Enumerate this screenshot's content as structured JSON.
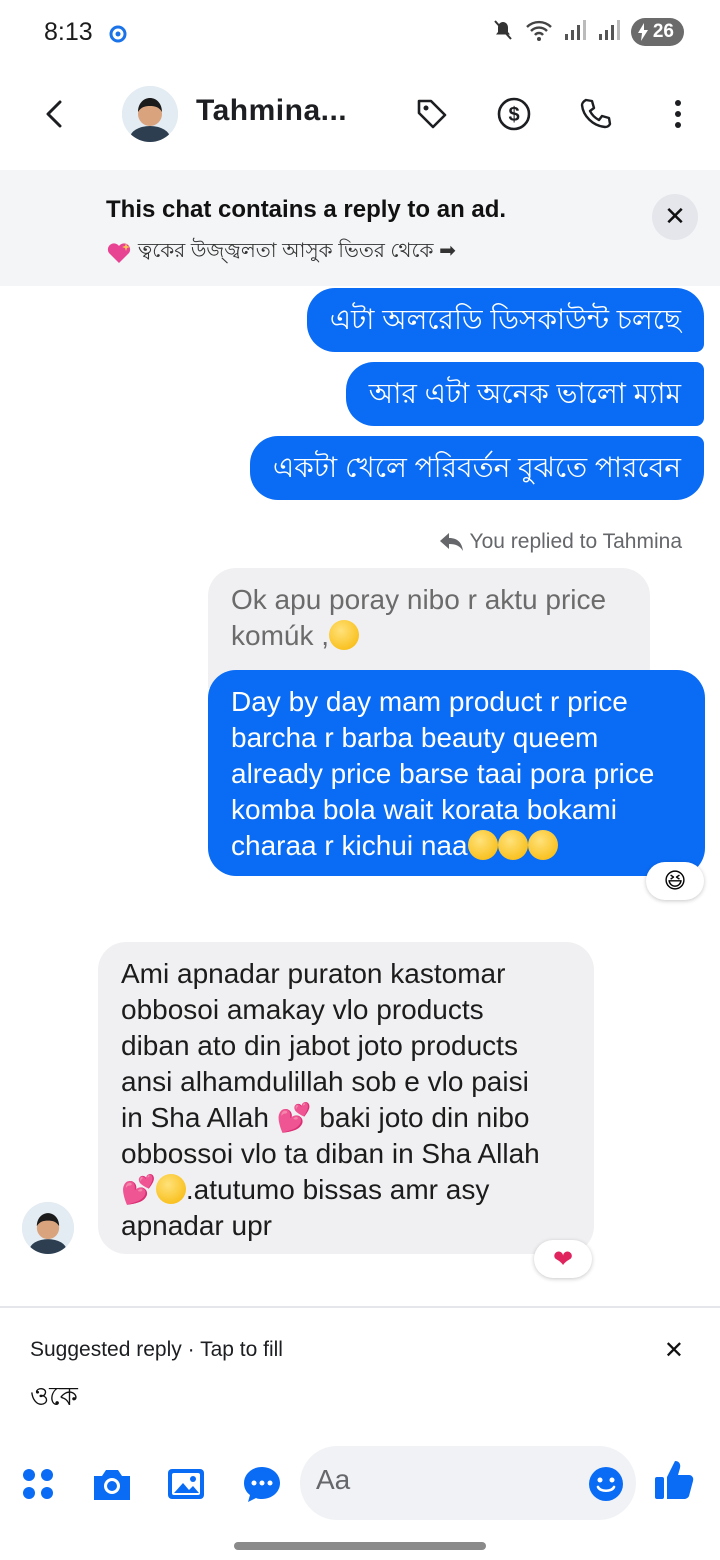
{
  "status_bar": {
    "time": "8:13",
    "battery": "26"
  },
  "header": {
    "contact_name": "Tahmina..."
  },
  "ad_banner": {
    "title": "This chat contains a reply to an ad.",
    "subtitle": "ত্বকের উজ্জ্বলতা আসুক ভিতর থেকে ➡"
  },
  "messages": {
    "out_1": "এটা অলরেডি ডিসকাউন্ট চলছে",
    "out_2": "আর এটা অনেক ভালো ম্যাম",
    "out_3": "একটা খেলে পরিবর্তন বুঝতে পারবেন",
    "replied_label": "You replied to Tahmina",
    "quoted_line1": "Ok apu poray nibo r aktu price",
    "quoted_line2": "komúk ,",
    "reply_lines": [
      "Day by day mam product r price",
      "barcha r barba beauty queem",
      "already price barse taai pora price",
      "komba bola wait korata bokami",
      "charaa r kichui naa"
    ],
    "reply_reaction": "😆",
    "incoming_lines": [
      "Ami apnadar  puraton kastomar",
      "obbosoi amakay vlo products",
      "diban  ato din jabot joto products",
      "ansi alhamdulillah sob e vlo paisi",
      "in Sha Allah",
      "baki joto din nibo",
      "obbossoi vlo ta diban in Sha Allah",
      ".atutumo bissas amr asy",
      "apnadar upr"
    ],
    "incoming_reaction": "❤"
  },
  "suggested": {
    "label": "Suggested reply",
    "tap_label": "Tap to fill",
    "text": "ওকে"
  },
  "composer": {
    "placeholder": "Aa"
  },
  "colors": {
    "accent": "#0a6cf5",
    "incoming_bg": "#f0f0f2",
    "banner_bg": "#f4f5f7"
  }
}
